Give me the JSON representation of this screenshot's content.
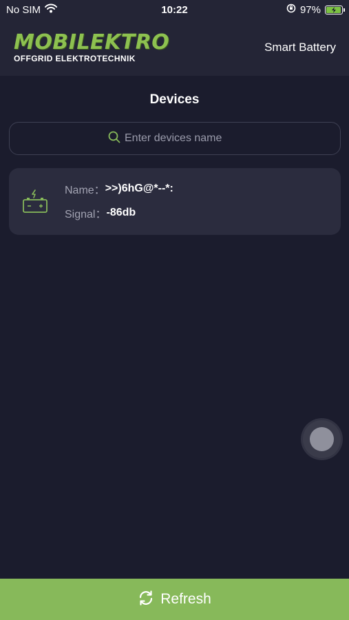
{
  "status_bar": {
    "carrier": "No SIM",
    "time": "10:22",
    "battery_percent": "97%",
    "battery_level": 0.97
  },
  "header": {
    "logo_main": "MOBILEKTRO",
    "logo_sub": "OFFGRID ELEKTROTECHNIK",
    "title": "Smart Battery"
  },
  "page": {
    "heading": "Devices"
  },
  "search": {
    "placeholder": "Enter devices name",
    "value": ""
  },
  "devices": [
    {
      "name_label": "Name：",
      "name_value": ">>)6hG@*--*:",
      "signal_label": "Signal：",
      "signal_value": "-86db",
      "icon": "battery-icon"
    }
  ],
  "footer": {
    "refresh_label": "Refresh",
    "icon": "refresh-icon"
  },
  "colors": {
    "accent": "#87b95a",
    "background": "#1b1c2d",
    "header": "#242536",
    "card": "#2b2c3e"
  }
}
